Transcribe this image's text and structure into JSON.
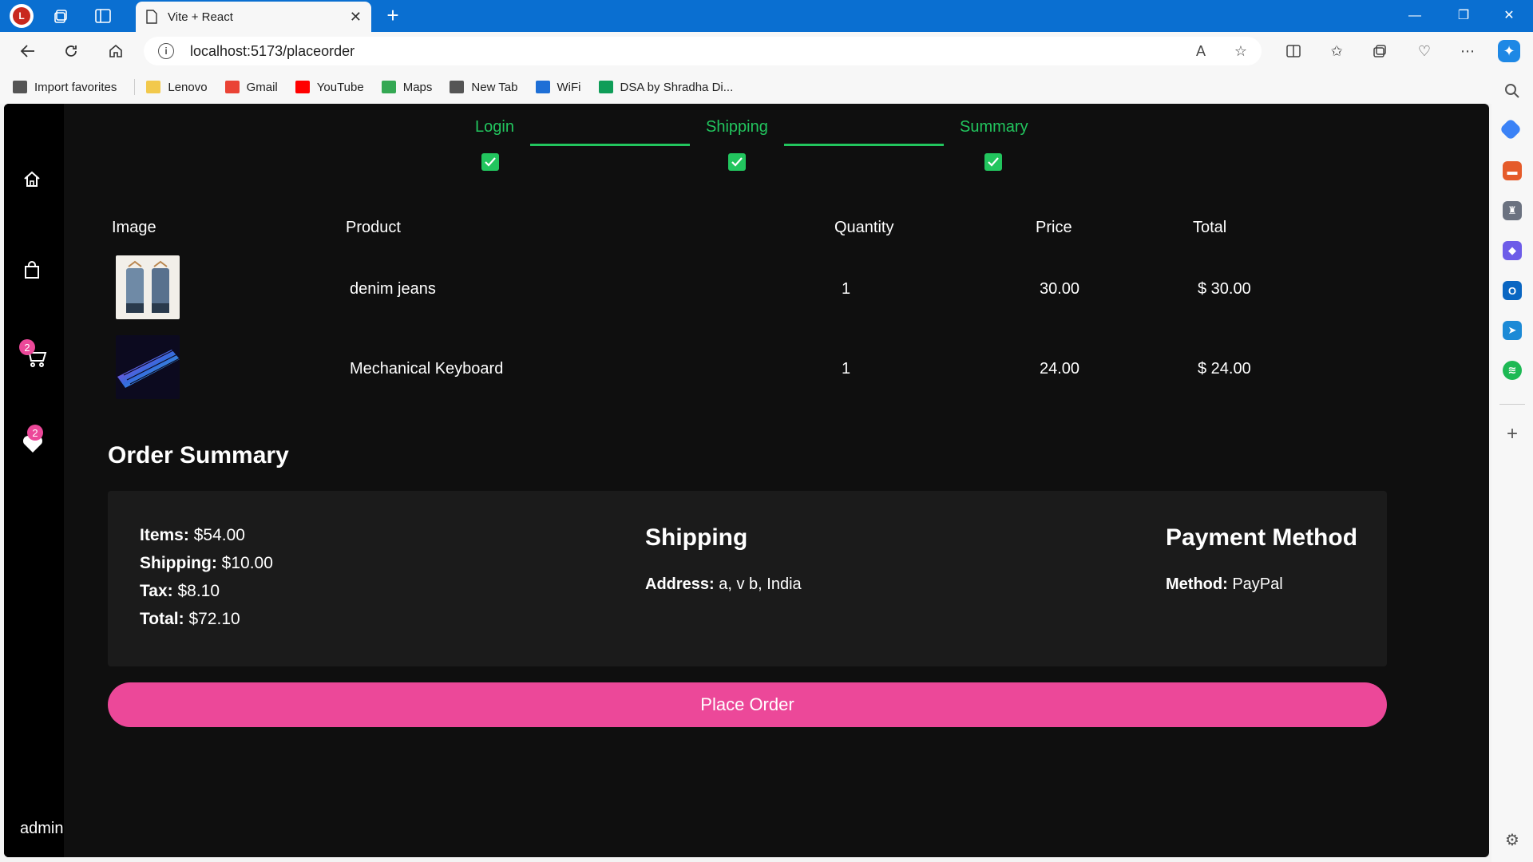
{
  "browser": {
    "tab_title": "Vite + React",
    "url": "localhost:5173/placeorder",
    "profile_initial": "L",
    "new_tab_symbol": "+",
    "favorites": [
      {
        "label": "Import favorites",
        "icon": "import-icon",
        "color": "#555555"
      },
      {
        "label": "Lenovo",
        "icon": "folder-icon",
        "color": "#f2c94c"
      },
      {
        "label": "Gmail",
        "icon": "gmail-icon",
        "color": "#ea4335"
      },
      {
        "label": "YouTube",
        "icon": "youtube-icon",
        "color": "#ff0000"
      },
      {
        "label": "Maps",
        "icon": "maps-icon",
        "color": "#34a853"
      },
      {
        "label": "New Tab",
        "icon": "page-icon",
        "color": "#555555"
      },
      {
        "label": "WiFi",
        "icon": "wifi-s-icon",
        "color": "#1e6fd6"
      },
      {
        "label": "DSA by Shradha Di...",
        "icon": "sheets-icon",
        "color": "#0f9d58"
      }
    ]
  },
  "sidebar": {
    "cart_count": "2",
    "favorites_count": "2",
    "username": "admin"
  },
  "stepper": {
    "steps": [
      {
        "label": "Login",
        "completed": true
      },
      {
        "label": "Shipping",
        "completed": true
      },
      {
        "label": "Summary",
        "completed": true
      }
    ],
    "color": "#22c55e"
  },
  "table": {
    "headers": [
      "Image",
      "Product",
      "Quantity",
      "Price",
      "Total"
    ],
    "rows": [
      {
        "image": "denim-jeans-thumbnail",
        "product": "denim jeans",
        "quantity": "1",
        "price": "30.00",
        "total": "$ 30.00"
      },
      {
        "image": "mechanical-keyboard-thumbnail",
        "product": "Mechanical Keyboard",
        "quantity": "1",
        "price": "24.00",
        "total": "$ 24.00"
      }
    ]
  },
  "order_summary": {
    "title": "Order Summary",
    "items_label": "Items:",
    "items_value": "$54.00",
    "shipping_label": "Shipping:",
    "shipping_value": "$10.00",
    "tax_label": "Tax:",
    "tax_value": "$8.10",
    "total_label": "Total:",
    "total_value": "$72.10",
    "shipping_heading": "Shipping",
    "address_label": "Address:",
    "address_value": "a, v b, India",
    "payment_heading": "Payment Method",
    "method_label": "Method:",
    "method_value": "PayPal"
  },
  "actions": {
    "place_order_label": "Place Order",
    "accent": "#ec4899"
  }
}
